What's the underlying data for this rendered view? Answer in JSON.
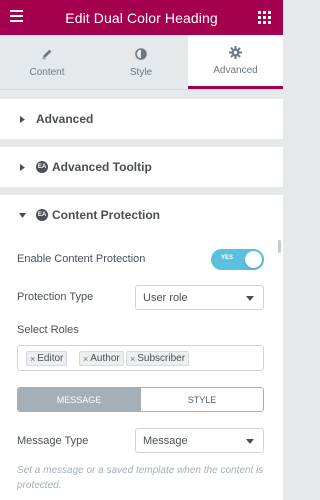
{
  "header": {
    "title": "Edit Dual Color Heading"
  },
  "tabs": [
    {
      "label": "Content",
      "icon": "pencil-icon"
    },
    {
      "label": "Style",
      "icon": "half-circle-icon"
    },
    {
      "label": "Advanced",
      "icon": "gear-icon",
      "active": true
    }
  ],
  "sections": [
    {
      "title": "Advanced",
      "expanded": false
    },
    {
      "title": "Advanced Tooltip",
      "badge": "EA",
      "expanded": false
    },
    {
      "title": "Content Protection",
      "badge": "EA",
      "expanded": true
    }
  ],
  "content_protection": {
    "enable_label": "Enable Content Protection",
    "enable_toggle_text": "YES",
    "enable_value": true,
    "protection_type_label": "Protection Type",
    "protection_type_value": "User role",
    "select_roles_label": "Select Roles",
    "roles": [
      "Editor",
      "Author",
      "Subscriber"
    ],
    "remove_glyph": "×",
    "segment_tabs": [
      {
        "label": "MESSAGE",
        "active": true
      },
      {
        "label": "STYLE",
        "active": false
      }
    ],
    "message_type_label": "Message Type",
    "message_type_value": "Message",
    "description": "Set a message or a saved template when the content is protected."
  },
  "colors": {
    "brand": "#a4004f",
    "toggle_on": "#5bc0de",
    "segment_active": "#a4afb7",
    "panel_bg": "#e6e9ec"
  }
}
